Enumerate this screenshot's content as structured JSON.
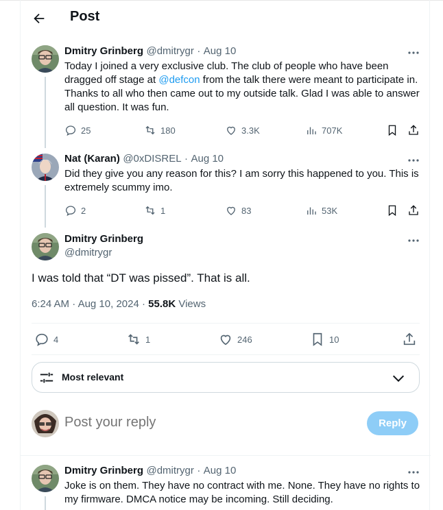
{
  "header": {
    "title": "Post"
  },
  "thread": {
    "post1": {
      "author_name": "Dmitry Grinberg",
      "handle": "@dmitrygr",
      "date": "Aug 10",
      "text_before_link": "Today I joined a very exclusive club. The club of people who have been dragged off stage at ",
      "link_text": "@defcon",
      "text_after_link": " from the talk there were meant to participate in. Thanks to all who then came out to my outside talk. Glad I was able to answer all question. It was fun.",
      "replies": "25",
      "reposts": "180",
      "likes": "3.3K",
      "views": "707K"
    },
    "post2": {
      "author_name": "Nat (Karan)",
      "handle": "@0xDISREL",
      "date": "Aug 10",
      "text": "Did they give you any reason for this? I am sorry this happened to you. This is extremely scummy imo.",
      "replies": "2",
      "reposts": "1",
      "likes": "83",
      "views": "53K"
    }
  },
  "main_post": {
    "author_name": "Dmitry Grinberg",
    "handle": "@dmitrygr",
    "text": "I was told that “DT was pissed”. That is all.",
    "time": "6:24 AM",
    "date": "Aug 10, 2024",
    "views_count": "55.8K",
    "views_label": "Views",
    "replies": "4",
    "reposts": "1",
    "likes": "246",
    "bookmarks": "10"
  },
  "sort": {
    "label": "Most relevant"
  },
  "composer": {
    "placeholder": "Post your reply",
    "reply_label": "Reply"
  },
  "reply_post": {
    "author_name": "Dmitry Grinberg",
    "handle": "@dmitrygr",
    "date": "Aug 10",
    "text": "Joke is on them. They have no contract with me. None. They have no rights to my firmware. DMCA notice may be incoming. Still deciding."
  },
  "colors": {
    "accent": "#1d9bf0",
    "reply_button": "#8ecdf7",
    "secondary_text": "#536471"
  }
}
